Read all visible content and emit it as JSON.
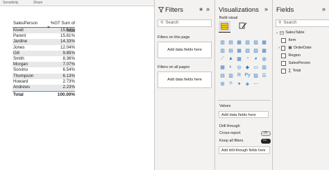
{
  "topbar": {
    "sensitivity": "Sensitivity",
    "share": "Share"
  },
  "table": {
    "headers": [
      "SalesPerson",
      "%GT Sum of Total"
    ],
    "rows": [
      [
        "Kivell",
        "15.84%"
      ],
      [
        "Parent",
        "15.81%"
      ],
      [
        "Jardine",
        "14.33%"
      ],
      [
        "Jones",
        "12.04%"
      ],
      [
        "Gill",
        "9.85%"
      ],
      [
        "Smith",
        "8.36%"
      ],
      [
        "Morgan",
        "7.07%"
      ],
      [
        "Sorvino",
        "6.54%"
      ],
      [
        "Thompson",
        "6.13%"
      ],
      [
        "Howard",
        "2.73%"
      ],
      [
        "Andrews",
        "2.23%"
      ]
    ],
    "total": [
      "Total",
      "100.00%"
    ]
  },
  "filters": {
    "title": "Filters",
    "search_placeholder": "Search",
    "on_page": "Filters on this page",
    "on_page_drop": "Add data fields here",
    "all_pages": "Filters on all pages",
    "all_pages_drop": "Add data fields here"
  },
  "viz": {
    "title": "Visualizations",
    "build": "Build visual",
    "values_label": "Values",
    "values_drop": "Add data fields here",
    "drill": "Drill through",
    "cross_report": "Cross-report",
    "cross_report_state": "Off",
    "keep_filters": "Keep all filters",
    "keep_filters_state": "On",
    "drill_drop": "Add drill-through fields here"
  },
  "fields": {
    "title": "Fields",
    "search_placeholder": "Search",
    "table_name": "SalesTable",
    "items": [
      "Item",
      "OrderDate",
      "Region",
      "SalesPerson",
      "Total"
    ]
  },
  "colors": {
    "accent": "#3b7dbf",
    "toggle_on": "#252423",
    "toggle_off": "#e1dfdd"
  }
}
